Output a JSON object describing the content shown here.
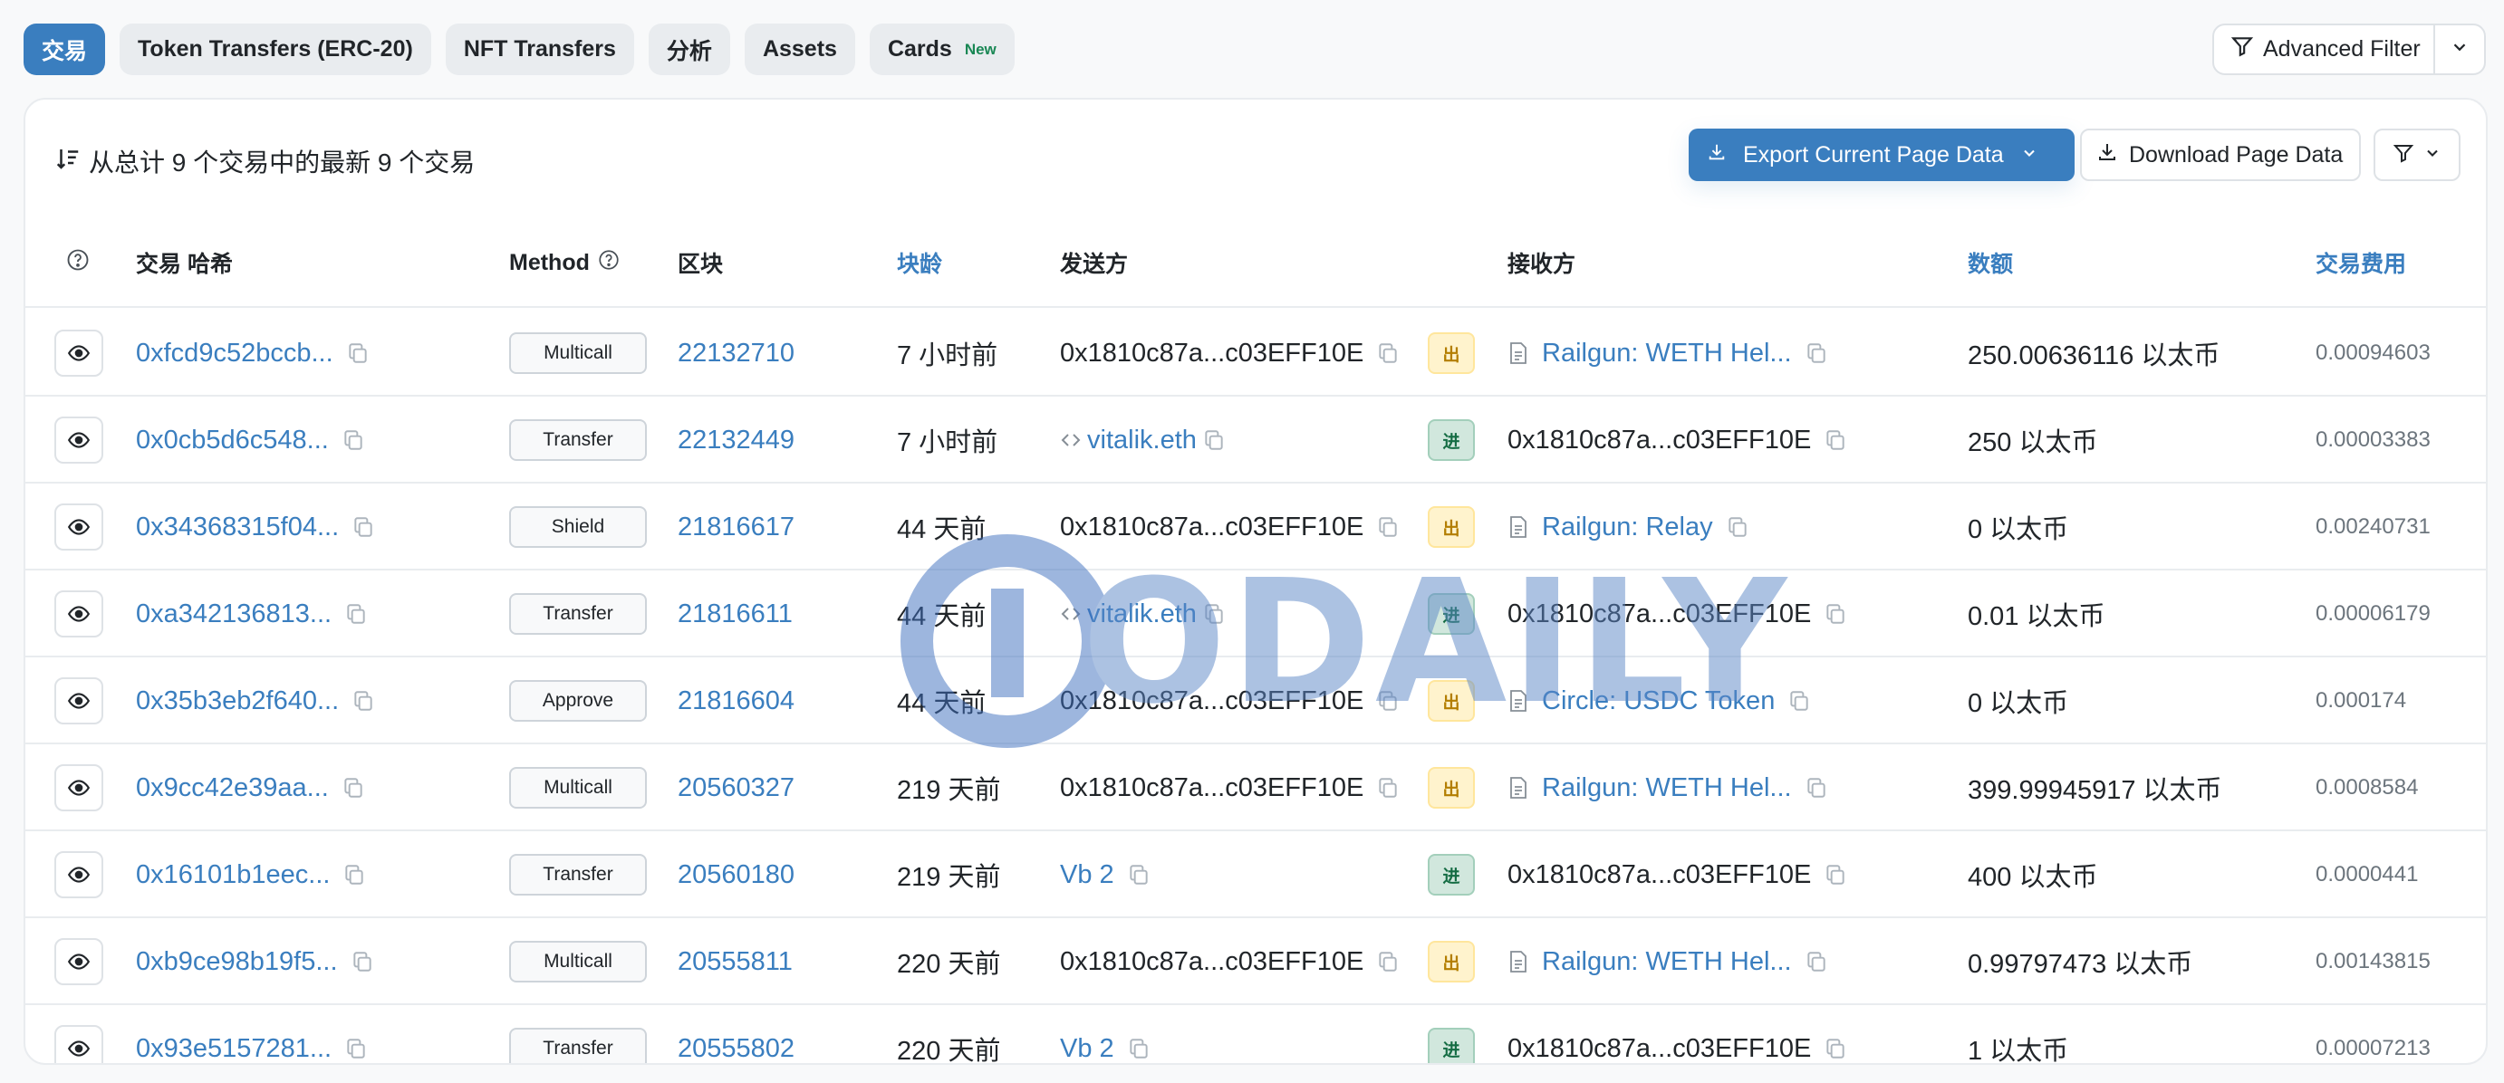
{
  "tabs": [
    {
      "label": "交易",
      "active": true
    },
    {
      "label": "Token Transfers (ERC-20)",
      "active": false
    },
    {
      "label": "NFT Transfers",
      "active": false
    },
    {
      "label": "分析",
      "active": false
    },
    {
      "label": "Assets",
      "active": false
    },
    {
      "label": "Cards",
      "badge": "New",
      "active": false
    }
  ],
  "advanced_filter": {
    "label": "Advanced Filter"
  },
  "summary": {
    "text": "从总计 9 个交易中的最新 9 个交易"
  },
  "actions": {
    "export_label": "Export Current Page Data",
    "download_label": "Download Page Data"
  },
  "columns": {
    "hash": "交易 哈希",
    "method": "Method",
    "block": "区块",
    "age": "块龄",
    "from": "发送方",
    "to": "接收方",
    "amount": "数额",
    "fee": "交易费用"
  },
  "rows": [
    {
      "hash": "0xfcd9c52bccb...",
      "method": "Multicall",
      "block": "22132710",
      "age": "7 小时前",
      "from": "0x1810c87a...c03EFF10E",
      "from_type": "address",
      "dir": "出",
      "dir_type": "out",
      "to": "Railgun: WETH Hel...",
      "to_type": "contract",
      "amount": "250.00636116 以太币",
      "fee": "0.00094603"
    },
    {
      "hash": "0x0cb5d6c548...",
      "method": "Transfer",
      "block": "22132449",
      "age": "7 小时前",
      "from": "vitalik.eth",
      "from_type": "ens",
      "dir": "进",
      "dir_type": "in",
      "to": "0x1810c87a...c03EFF10E",
      "to_type": "address",
      "amount": "250 以太币",
      "fee": "0.00003383"
    },
    {
      "hash": "0x34368315f04...",
      "method": "Shield",
      "block": "21816617",
      "age": "44 天前",
      "from": "0x1810c87a...c03EFF10E",
      "from_type": "address",
      "dir": "出",
      "dir_type": "out",
      "to": "Railgun: Relay",
      "to_type": "contract",
      "amount": "0 以太币",
      "fee": "0.00240731"
    },
    {
      "hash": "0xa342136813...",
      "method": "Transfer",
      "block": "21816611",
      "age": "44 天前",
      "from": "vitalik.eth",
      "from_type": "ens",
      "dir": "进",
      "dir_type": "in",
      "to": "0x1810c87a...c03EFF10E",
      "to_type": "address",
      "amount": "0.01 以太币",
      "fee": "0.00006179"
    },
    {
      "hash": "0x35b3eb2f640...",
      "method": "Approve",
      "block": "21816604",
      "age": "44 天前",
      "from": "0x1810c87a...c03EFF10E",
      "from_type": "address",
      "dir": "出",
      "dir_type": "out",
      "to": "Circle: USDC Token",
      "to_type": "contract",
      "amount": "0 以太币",
      "fee": "0.000174"
    },
    {
      "hash": "0x9cc42e39aa...",
      "method": "Multicall",
      "block": "20560327",
      "age": "219 天前",
      "from": "0x1810c87a...c03EFF10E",
      "from_type": "address",
      "dir": "出",
      "dir_type": "out",
      "to": "Railgun: WETH Hel...",
      "to_type": "contract",
      "amount": "399.99945917 以太币",
      "fee": "0.0008584"
    },
    {
      "hash": "0x16101b1eec...",
      "method": "Transfer",
      "block": "20560180",
      "age": "219 天前",
      "from": "Vb 2",
      "from_type": "named",
      "dir": "进",
      "dir_type": "in",
      "to": "0x1810c87a...c03EFF10E",
      "to_type": "address",
      "amount": "400 以太币",
      "fee": "0.0000441"
    },
    {
      "hash": "0xb9ce98b19f5...",
      "method": "Multicall",
      "block": "20555811",
      "age": "220 天前",
      "from": "0x1810c87a...c03EFF10E",
      "from_type": "address",
      "dir": "出",
      "dir_type": "out",
      "to": "Railgun: WETH Hel...",
      "to_type": "contract",
      "amount": "0.99797473 以太币",
      "fee": "0.00143815"
    },
    {
      "hash": "0x93e5157281...",
      "method": "Transfer",
      "block": "20555802",
      "age": "220 天前",
      "from": "Vb 2",
      "from_type": "named",
      "dir": "进",
      "dir_type": "in",
      "to": "0x1810c87a...c03EFF10E",
      "to_type": "address",
      "amount": "1 以太币",
      "fee": "0.00007213"
    }
  ],
  "watermark": {
    "text": "ODAILY"
  },
  "colors": {
    "accent": "#3a7ebf",
    "out": "#b37e00",
    "in": "#146c43"
  },
  "icons": [
    "sort-icon",
    "eye-icon",
    "copy-icon",
    "help-icon",
    "download-icon",
    "filter-icon",
    "chevron-down-icon",
    "doc-icon",
    "code-icon"
  ]
}
